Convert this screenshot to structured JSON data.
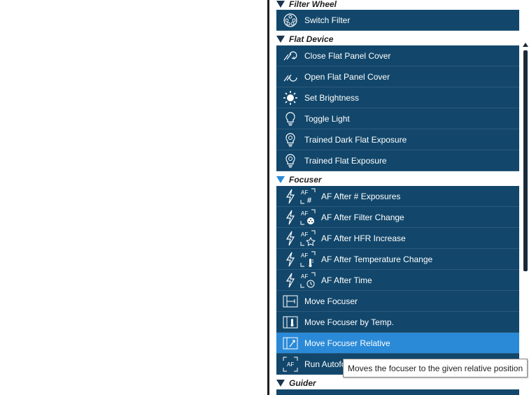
{
  "groups": {
    "filter_wheel": {
      "title": "Filter Wheel",
      "items": [
        "Switch Filter"
      ]
    },
    "flat_device": {
      "title": "Flat Device",
      "items": [
        "Close Flat Panel Cover",
        "Open Flat Panel Cover",
        "Set Brightness",
        "Toggle Light",
        "Trained Dark Flat Exposure",
        "Trained Flat Exposure"
      ]
    },
    "focuser": {
      "title": "Focuser",
      "items": [
        "AF After # Exposures",
        "AF After Filter Change",
        "AF After HFR Increase",
        "AF After Temperature Change",
        "AF After Time",
        "Move Focuser",
        "Move Focuser by Temp.",
        "Move Focuser Relative",
        "Run Autofocus"
      ]
    },
    "guider": {
      "title": "Guider"
    }
  },
  "af_label": "AF",
  "tooltip": "Moves the focuser to the given relative position",
  "colors": {
    "item_bg": "#12476b",
    "selected_bg": "#2a8ad8",
    "expanded_triangle": "#2a8ad8"
  }
}
